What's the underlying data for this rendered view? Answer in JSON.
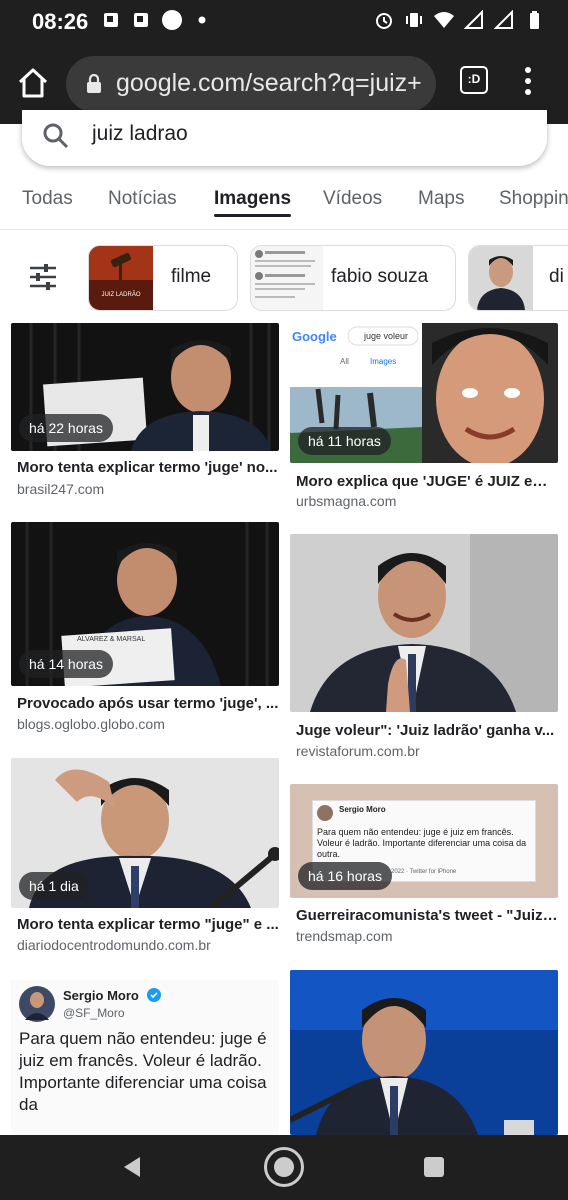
{
  "status_bar": {
    "time": "08:26",
    "left_icons": [
      "notification-icon",
      "notification-icon",
      "circle-icon",
      "dot-icon"
    ],
    "right_icons": [
      "alarm-icon",
      "vibrate-icon",
      "wifi-icon",
      "signal-icon",
      "signal-icon",
      "battery-icon"
    ]
  },
  "browser": {
    "url": "google.com/search?q=juiz+",
    "tabs_label": ":D"
  },
  "search": {
    "query": "juiz ladrao"
  },
  "tabs": [
    "Todas",
    "Notícias",
    "Imagens",
    "Vídeos",
    "Maps",
    "Shoppin"
  ],
  "active_tab": "Imagens",
  "chips": [
    {
      "label": "filme",
      "thumb_text": "JUIZ LADRÃO"
    },
    {
      "label": "fabio souza"
    },
    {
      "label": "di"
    }
  ],
  "results": [
    {
      "time": "há 22 horas",
      "title": "Moro tenta explicar termo 'juge' no...",
      "source": "brasil247.com"
    },
    {
      "time": "há 11 horas",
      "title": "Moro explica que 'JUGE' é JUIZ em...",
      "source": "urbsmagna.com",
      "thumb_labels": [
        "Google",
        "juge voleur",
        "All",
        "Images"
      ]
    },
    {
      "time": "há 14 horas",
      "title": "Provocado após usar termo 'juge', ...",
      "source": "blogs.oglobo.globo.com",
      "thumb_text": "ALVAREZ & MARSAL"
    },
    {
      "title": "Juge voleur\": 'Juiz ladrão' ganha v...",
      "source": "revistaforum.com.br"
    },
    {
      "time": "há 1 dia",
      "title": "Moro tenta explicar termo \"juge\" e ...",
      "source": "diariodocentrodomundo.com.br"
    },
    {
      "time": "há 16 horas",
      "title": "Guerreiracomunista's tweet - \"Juiz ...",
      "source": "trendsmap.com",
      "thumb_name": "Sergio Moro",
      "thumb_text": "Para quem não entendeu: juge é juiz em francês. Voleur é ladrão. Importante diferenciar uma coisa da outra.",
      "thumb_meta": "2022 · Twitter for iPhone"
    },
    {
      "tweet_name": "Sergio Moro",
      "tweet_handle": "@SF_Moro",
      "tweet_text": "Para quem não entendeu: juge é juiz em francês. Voleur é ladrão. Importante diferenciar uma coisa da"
    },
    {}
  ],
  "colors": {
    "chrome_dark": "#1f1f1f",
    "url_bar": "#3a3a3a",
    "text_primary": "#202124",
    "text_secondary": "#5f6368",
    "twitter_blue": "#1d9bf0"
  }
}
